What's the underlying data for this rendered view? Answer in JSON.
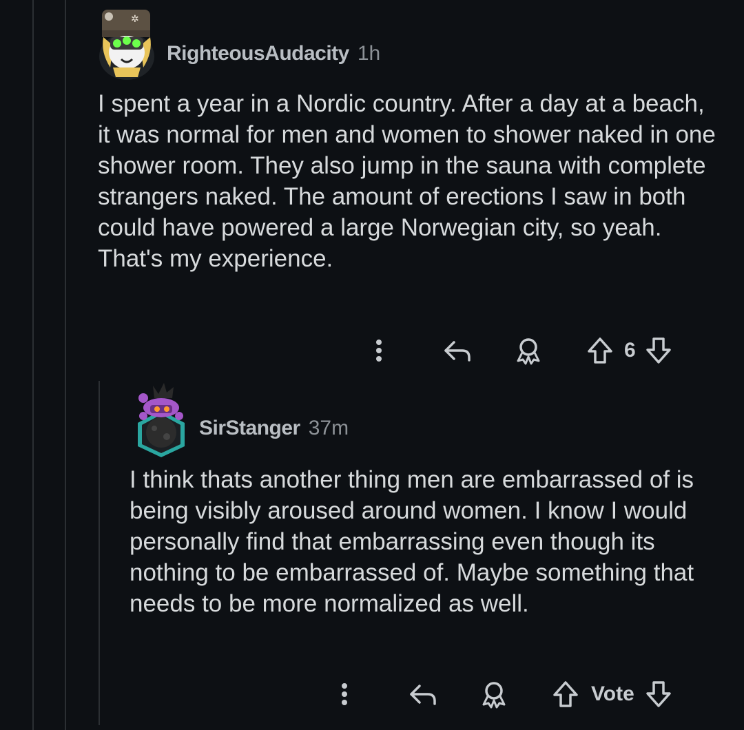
{
  "comments": [
    {
      "username": "RighteousAudacity",
      "time": "1h",
      "body": "I spent a year in a Nordic country. After a day at a beach, it was normal for men and women to shower naked in one shower room. They also jump in the sauna with complete strangers naked. The amount of erections I saw in both could have powered a large Norwegian city, so yeah. That's my experience.",
      "vote_label": "6"
    },
    {
      "username": "SirStanger",
      "time": "37m",
      "body": "I think thats another thing men are embarrassed of is being visibly aroused around women. I know I would personally find that embarrassing even though its nothing to be embarrassed of. Maybe something that needs to be more normalized as well.",
      "vote_label": "Vote"
    }
  ],
  "icons": {
    "more": "more-vertical-icon",
    "reply": "reply-icon",
    "award": "award-icon",
    "upvote": "upvote-icon",
    "downvote": "downvote-icon"
  },
  "colors": {
    "background": "#0d1014",
    "text": "#d7dadc",
    "username": "#b9bec3",
    "meta": "#8c9196"
  }
}
